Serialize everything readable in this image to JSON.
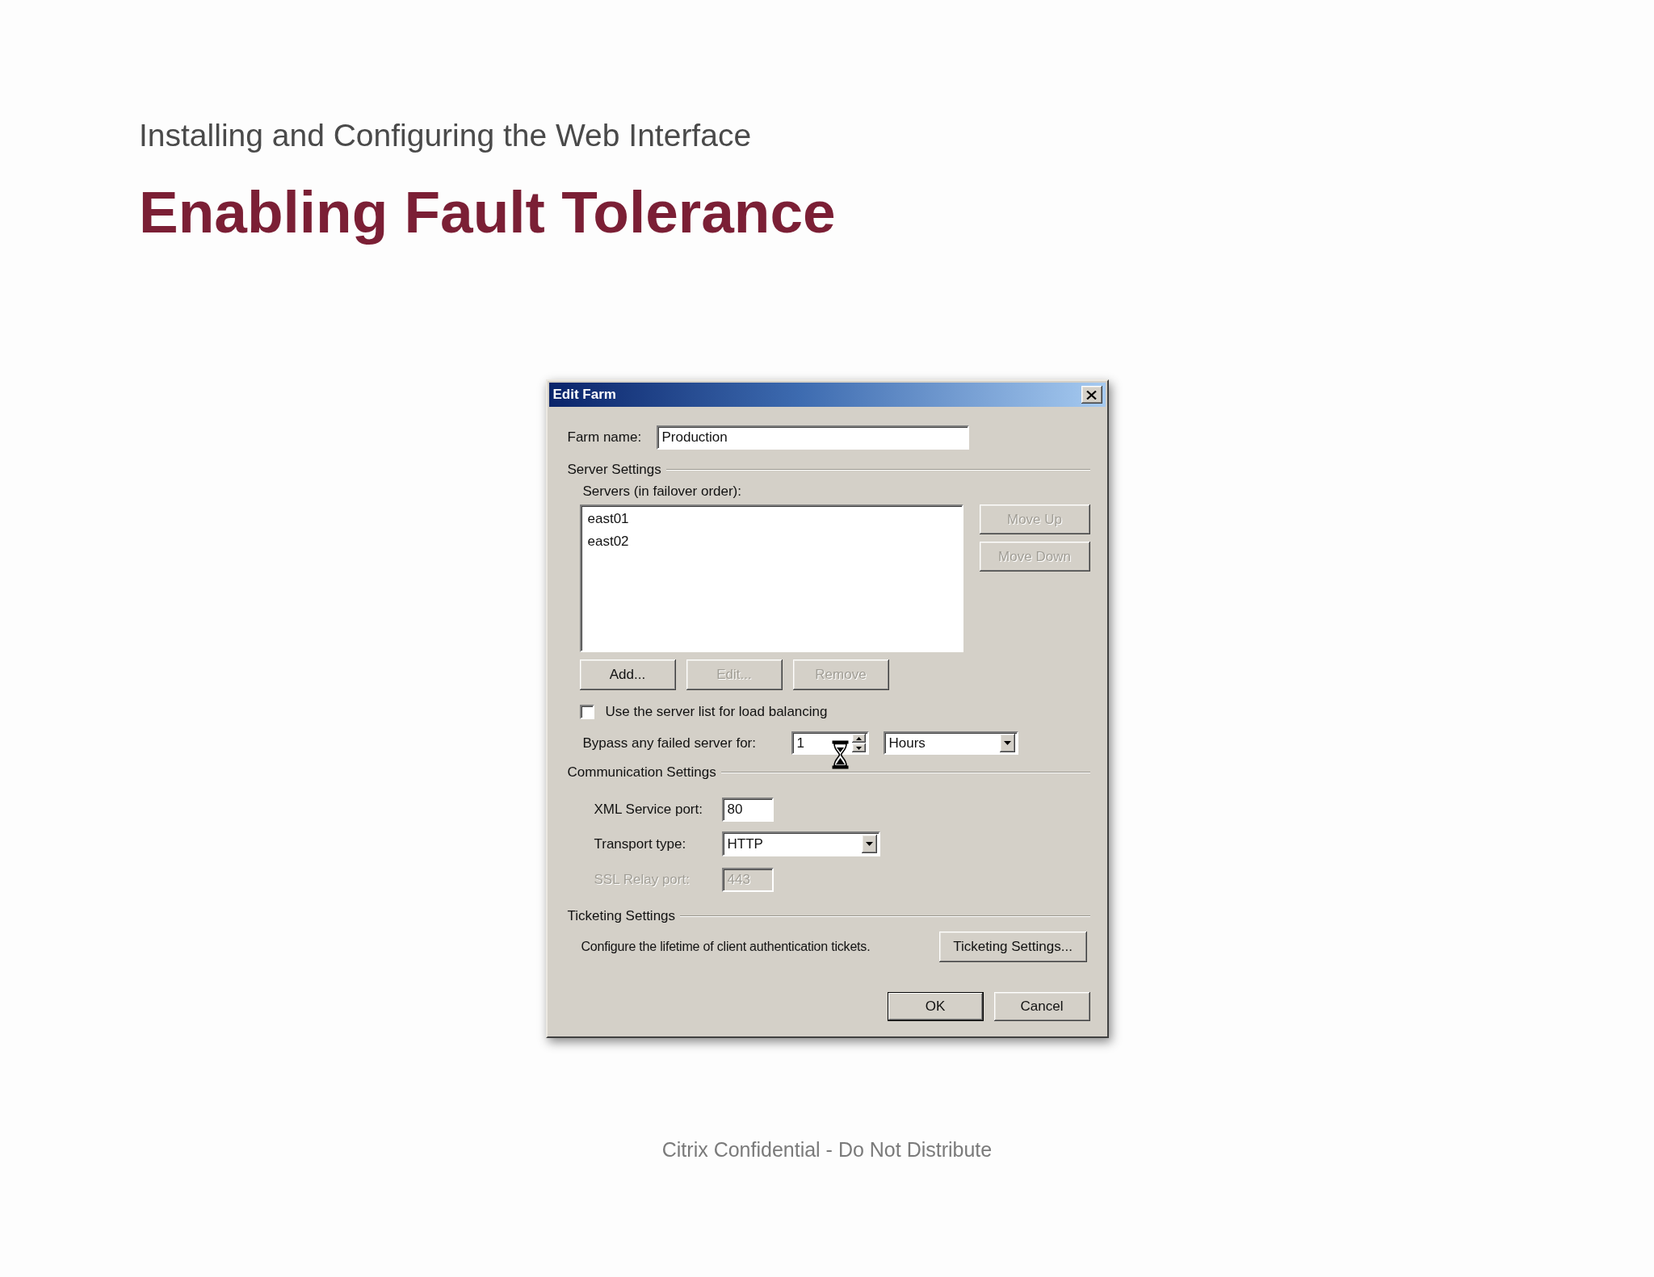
{
  "header": {
    "subtitle": "Installing and Configuring the Web Interface",
    "title": "Enabling Fault Tolerance"
  },
  "dialog": {
    "title": "Edit Farm",
    "farm_name": {
      "label": "Farm name:",
      "value": "Production"
    },
    "server_settings": {
      "heading": "Server Settings",
      "list_label": "Servers (in failover order):",
      "servers": [
        {
          "name": "east01",
          "selected": false
        },
        {
          "name": "east02",
          "selected": false
        }
      ],
      "order_buttons": [
        {
          "label": "Move Up",
          "disabled": true
        },
        {
          "label": "Move Down",
          "disabled": true
        }
      ],
      "list_buttons": [
        {
          "label": "Add...",
          "disabled": false
        },
        {
          "label": "Edit...",
          "disabled": true
        },
        {
          "label": "Remove",
          "disabled": true
        }
      ],
      "load_balancing": {
        "label": "Use the server list for load balancing",
        "checked": false
      },
      "bypass": {
        "label": "Bypass any failed server for:",
        "value": "1",
        "unit": "Hours"
      }
    },
    "communication_settings": {
      "heading": "Communication Settings",
      "fields": [
        {
          "kind": "text",
          "label": "XML Service port:",
          "value": "80",
          "disabled": false
        },
        {
          "kind": "dropdown",
          "label": "Transport type:",
          "value": "HTTP",
          "disabled": false
        },
        {
          "kind": "text",
          "label": "SSL Relay port:",
          "value": "443",
          "disabled": true
        }
      ]
    },
    "ticketing_settings": {
      "heading": "Ticketing Settings",
      "description": "Configure the lifetime of client authentication tickets.",
      "button": "Ticketing Settings..."
    },
    "buttons": [
      {
        "label": "OK",
        "default": true
      },
      {
        "label": "Cancel",
        "default": false
      }
    ]
  },
  "footer": "Citrix Confidential - Do Not Distribute"
}
